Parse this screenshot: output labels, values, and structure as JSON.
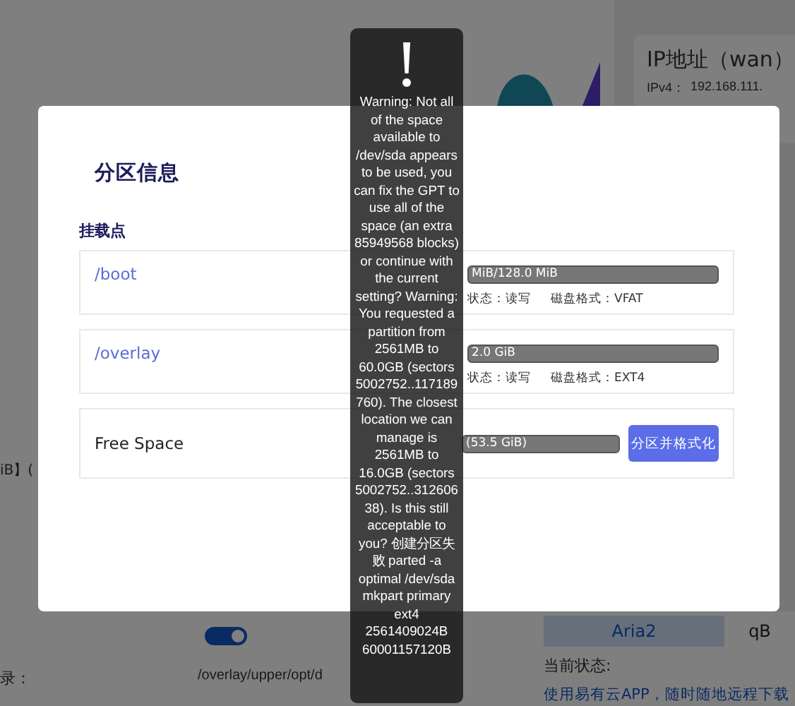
{
  "background": {
    "ip_card": {
      "title": "IP地址（wan）",
      "label": "IPv4：",
      "value": "192.168.111."
    },
    "left": {
      "size_text": "iB】(",
      "toggle": {
        "on": true
      },
      "dir_label": "录：",
      "dir_value": "/overlay/upper/opt/d"
    },
    "download": {
      "tabs": [
        {
          "label": "Aria2",
          "selected": true
        },
        {
          "label": "qB",
          "selected": false
        }
      ],
      "status_label": "当前状态:",
      "link": "使用易有云APP，随时随地远程下载"
    }
  },
  "dialog": {
    "title": "分区信息",
    "section": "挂载点",
    "partitions": [
      {
        "kind": "mounted",
        "mount": "/boot",
        "usage": "MiB/128.0 MiB",
        "rw": "状态：读写",
        "format": "磁盘格式：VFAT"
      },
      {
        "kind": "mounted",
        "mount": "/overlay",
        "usage": "2.0 GiB",
        "rw": "状态：读写",
        "format": "磁盘格式：EXT4"
      },
      {
        "kind": "free",
        "name": "Free Space",
        "usage": "(53.5 GiB)",
        "button": "分区并格式化"
      }
    ]
  },
  "toast": {
    "message": "Warning: Not all of the space available to /dev/sda appears to be used, you can fix the GPT to use all of the space (an extra 85949568 blocks) or continue with the current setting? Warning: You requested a partition from 2561MB to 60.0GB (sectors 5002752..117189760). The closest location we can manage is 2561MB to 16.0GB (sectors 5002752..31260638). Is this still acceptable to you? 创建分区失败 parted -a optimal /dev/sda mkpart primary ext4 2561409024B 60001157120B"
  }
}
